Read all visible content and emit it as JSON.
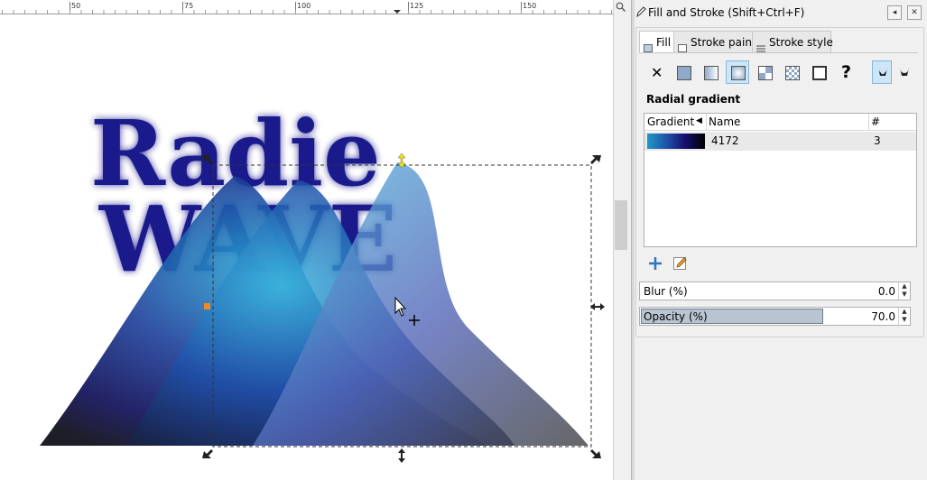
{
  "canvas": {
    "ruler_labels": [
      "50",
      "75",
      "100",
      "125",
      "150"
    ],
    "artwork_text": [
      "Radie",
      "WAVE"
    ],
    "colors": {
      "text": "#1a1a8c",
      "wave_light": "#2aa4d4",
      "wave_dark": "#0a0a50"
    }
  },
  "panel": {
    "title": "Fill and Stroke (Shift+Ctrl+F)",
    "title_icon": "pen-icon",
    "btn_iconify": "◂",
    "btn_close": "✕",
    "tabs": [
      {
        "label": "Fill",
        "icon": "fill-icon"
      },
      {
        "label": "Stroke paint",
        "icon": "stroke-paint-icon"
      },
      {
        "label": "Stroke style",
        "icon": "stroke-style-icon"
      }
    ],
    "paint_types": [
      "no-paint",
      "flat-color",
      "linear-gradient",
      "radial-gradient",
      "pattern",
      "swatch",
      "unset",
      "unknown"
    ],
    "no_paint_glyph": "✕",
    "unset_glyph": "?",
    "section_label": "Radial gradient",
    "gradient_list": {
      "headers": {
        "gradient": "Gradient",
        "name": "Name",
        "count": "#"
      },
      "rows": [
        {
          "name": "4172",
          "count": "3"
        }
      ]
    },
    "blur": {
      "label": "Blur (%)",
      "value": "0.0"
    },
    "opacity": {
      "label": "Opacity (%)",
      "value": "70.0",
      "level": 0.7
    }
  }
}
